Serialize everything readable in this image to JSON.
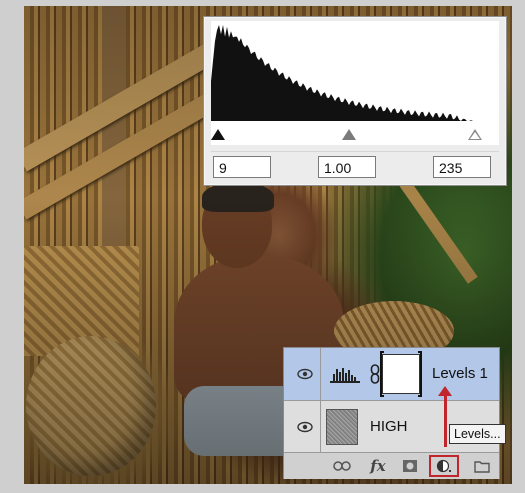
{
  "levels_panel": {
    "black_input": "9",
    "gamma_input": "1.00",
    "white_input": "235",
    "histogram_color": "#111111"
  },
  "layers_panel": {
    "layers": [
      {
        "name": "Levels 1",
        "type": "adjustment-levels",
        "selected": true
      },
      {
        "name": "HIGH",
        "type": "pixel",
        "selected": false
      }
    ],
    "toolbar": {
      "icons": [
        "link-layers-icon",
        "fx-icon",
        "add-mask-icon",
        "new-adjustment-layer-icon",
        "new-group-folder-icon"
      ],
      "fx_label": "fx"
    }
  },
  "tooltip": {
    "text": "Levels..."
  },
  "colors": {
    "selection": "#b3c7e8",
    "highlight_red": "#c0262c"
  }
}
